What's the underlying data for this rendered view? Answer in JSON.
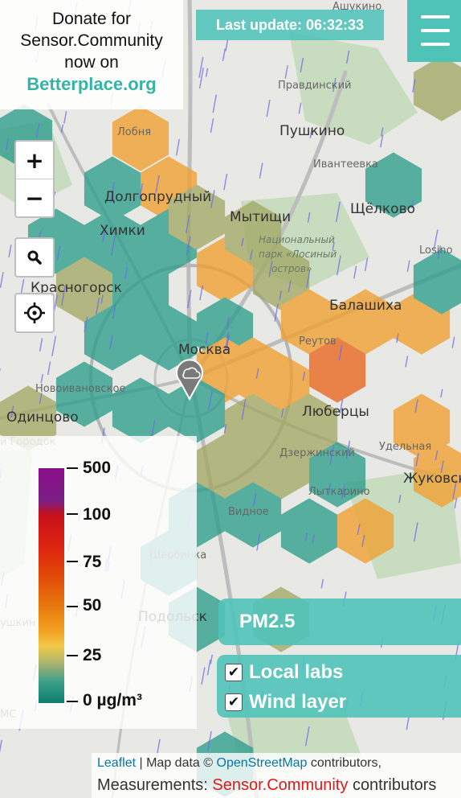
{
  "donate": {
    "line1": "Donate for",
    "line2": "Sensor.Community",
    "line3": "now on",
    "link": "Betterplace.org"
  },
  "last_update": "Last update: 06:32:33",
  "menu": {
    "icon": "hamburger-menu-icon"
  },
  "zoom": {
    "in_label": "+",
    "out_label": "−"
  },
  "search": {
    "icon": "search-icon"
  },
  "locate": {
    "icon": "crosshair-icon"
  },
  "marker": {
    "icon": "cloud-location-pin-icon"
  },
  "map_labels": [
    {
      "id": "ashukino",
      "text": "Ашукино",
      "cls": "small"
    },
    {
      "id": "pravdinsky",
      "text": "Правдинский",
      "cls": "small"
    },
    {
      "id": "pushkino",
      "text": "Пушкино",
      "cls": "big"
    },
    {
      "id": "lobnya",
      "text": "Лобня",
      "cls": "small"
    },
    {
      "id": "ivanteevka",
      "text": "Ивантеевка",
      "cls": "small"
    },
    {
      "id": "dolgoprudny",
      "text": "Долгопрудный",
      "cls": "big"
    },
    {
      "id": "mytishchi",
      "text": "Мытищи",
      "cls": "big"
    },
    {
      "id": "shchelkovo",
      "text": "Щёлково",
      "cls": "big"
    },
    {
      "id": "khimki",
      "text": "Химки",
      "cls": "big"
    },
    {
      "id": "park1",
      "text": "Национальный",
      "cls": "park"
    },
    {
      "id": "park2",
      "text": "парк «Лосиный",
      "cls": "park"
    },
    {
      "id": "park3",
      "text": "остров»",
      "cls": "park"
    },
    {
      "id": "losino",
      "text": "Losino",
      "cls": "small"
    },
    {
      "id": "krasnogorsk",
      "text": "Красногорск",
      "cls": "big"
    },
    {
      "id": "balashikha",
      "text": "Балашиха",
      "cls": "big"
    },
    {
      "id": "moskva",
      "text": "Москва",
      "cls": "big"
    },
    {
      "id": "reutov",
      "text": "Реутов",
      "cls": "small"
    },
    {
      "id": "novoivanovskoe",
      "text": "Новоивановское",
      "cls": "small"
    },
    {
      "id": "odintsovo",
      "text": "Одинцово",
      "cls": "big"
    },
    {
      "id": "lyubertsy",
      "text": "Люберцы",
      "cls": "big"
    },
    {
      "id": "gorodok",
      "text": "й Городок",
      "cls": "small"
    },
    {
      "id": "udelnaya",
      "text": "Удельная",
      "cls": "small"
    },
    {
      "id": "dzerzhinsky",
      "text": "Дзержинский",
      "cls": "small"
    },
    {
      "id": "zhukovsky",
      "text": "Жуковск",
      "cls": "big"
    },
    {
      "id": "lytkarino",
      "text": "Лыткарино",
      "cls": "small"
    },
    {
      "id": "vidnoe",
      "text": "Видное",
      "cls": "small"
    },
    {
      "id": "shcherbinka",
      "text": "Щербинка",
      "cls": "small"
    },
    {
      "id": "podolsk",
      "text": "Подольск",
      "cls": "big"
    },
    {
      "id": "ushkin",
      "text": "ушкин",
      "cls": "small"
    },
    {
      "id": "mc",
      "text": "МС",
      "cls": "small"
    }
  ],
  "legend": {
    "labels": [
      "500",
      "100",
      "75",
      "50",
      "25",
      "0 µg/m³"
    ]
  },
  "pm_panel": {
    "label": "PM2.5"
  },
  "layers": {
    "local_labs": {
      "label": "Local labs",
      "checked": true
    },
    "wind_layer": {
      "label": "Wind layer",
      "checked": true
    }
  },
  "attribution": {
    "leaflet": "Leaflet",
    "map_data": "| Map data ©",
    "osm": "OpenStreetMap",
    "contributors": "contributors,",
    "measurements": "Measurements:",
    "sensor": "Sensor.Community",
    "contributors2": "contributors"
  },
  "colors": {
    "teal": "#2e9e8c",
    "olive": "#a3a964",
    "orange": "#f0a030",
    "orange_red": "#e8661e",
    "accent": "#4fc3b8"
  }
}
